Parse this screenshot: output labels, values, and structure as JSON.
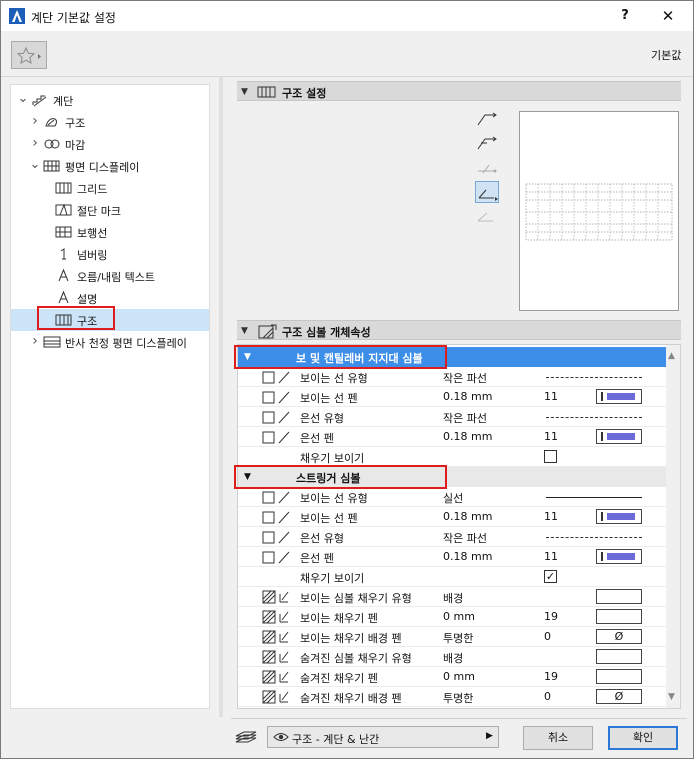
{
  "window": {
    "title": "계단 기본값 설정",
    "help": "?",
    "close": "✕"
  },
  "toolbar": {
    "default_label": "기본값"
  },
  "tree": [
    {
      "label": "계단",
      "indent": 0,
      "arrow": "down",
      "icon": "stair-icon"
    },
    {
      "label": "구조",
      "indent": 1,
      "arrow": "right",
      "icon": "structure-icon"
    },
    {
      "label": "마감",
      "indent": 1,
      "arrow": "right",
      "icon": "finish-icon"
    },
    {
      "label": "평면 디스플레이",
      "indent": 1,
      "arrow": "down",
      "icon": "floorplan-display-icon"
    },
    {
      "label": "그리드",
      "indent": 2,
      "arrow": "",
      "icon": "grid-icon"
    },
    {
      "label": "절단 마크",
      "indent": 2,
      "arrow": "",
      "icon": "break-mark-icon"
    },
    {
      "label": "보행선",
      "indent": 2,
      "arrow": "",
      "icon": "walking-line-icon"
    },
    {
      "label": "넘버링",
      "indent": 2,
      "arrow": "",
      "icon": "numbering-icon"
    },
    {
      "label": "오름/내림 텍스트",
      "indent": 2,
      "arrow": "",
      "icon": "text-icon"
    },
    {
      "label": "설명",
      "indent": 2,
      "arrow": "",
      "icon": "text-icon"
    },
    {
      "label": "구조",
      "indent": 2,
      "arrow": "",
      "icon": "structure-display-icon",
      "selected": true
    },
    {
      "label": "반사 천정 평면 디스플레이",
      "indent": 1,
      "arrow": "right",
      "icon": "rcp-icon"
    }
  ],
  "structure_section": {
    "title": "구조 설정"
  },
  "properties_section": {
    "title": "구조 심볼 개체속성"
  },
  "groups": {
    "beam": {
      "label": "보 및 캔틸레버 지지대 심볼"
    },
    "stringer": {
      "label": "스트링거 심볼"
    }
  },
  "beam_rows": [
    {
      "label": "보이는 선 유형",
      "value": "작은 파선",
      "kind": "dashed-line"
    },
    {
      "label": "보이는 선 펜",
      "value": "0.18 mm",
      "num": "11",
      "kind": "pen"
    },
    {
      "label": "은선 유형",
      "value": "작은 파선",
      "kind": "dashed-line"
    },
    {
      "label": "은선 펜",
      "value": "0.18 mm",
      "num": "11",
      "kind": "pen"
    },
    {
      "label": "채우기 보이기",
      "value": "",
      "kind": "checkbox",
      "checked": false
    }
  ],
  "stringer_rows": [
    {
      "label": "보이는 선 유형",
      "value": "실선",
      "kind": "solid-line"
    },
    {
      "label": "보이는 선 펜",
      "value": "0.18 mm",
      "num": "11",
      "kind": "pen"
    },
    {
      "label": "은선 유형",
      "value": "작은 파선",
      "kind": "dashed-line"
    },
    {
      "label": "은선 펜",
      "value": "0.18 mm",
      "num": "11",
      "kind": "pen"
    },
    {
      "label": "채우기 보이기",
      "value": "",
      "kind": "checkbox",
      "checked": true,
      "check_glyph": "✓"
    },
    {
      "label": "보이는 심볼 채우기 유형",
      "value": "배경",
      "kind": "fill"
    },
    {
      "label": "보이는 채우기 펜",
      "value": "0 mm",
      "num": "19",
      "kind": "fill"
    },
    {
      "label": "보이는 채우기 배경 펜",
      "value": "투명한",
      "num": "0",
      "kind": "fill-empty",
      "swatch_text": "Ø"
    },
    {
      "label": "숨겨진 심볼 채우기 유형",
      "value": "배경",
      "kind": "fill"
    },
    {
      "label": "숨겨진 채우기 펜",
      "value": "0 mm",
      "num": "19",
      "kind": "fill"
    },
    {
      "label": "숨겨진 채우기 배경 펜",
      "value": "투명한",
      "num": "0",
      "kind": "fill-empty",
      "swatch_text": "Ø"
    }
  ],
  "footer": {
    "layer": "구조 - 계단 & 난간",
    "cancel": "취소",
    "ok": "확인"
  },
  "colors": {
    "selection_blue": "#3d8ee8",
    "highlight_red": "#e01b1b",
    "pen_color": "#6a6ad8"
  }
}
